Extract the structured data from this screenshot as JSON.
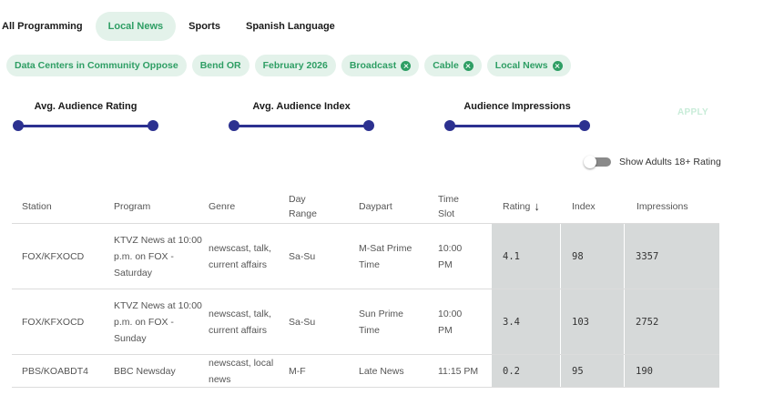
{
  "tabs": [
    {
      "label": "All Programming",
      "active": false
    },
    {
      "label": "Local News",
      "active": true
    },
    {
      "label": "Sports",
      "active": false
    },
    {
      "label": "Spanish Language",
      "active": false
    }
  ],
  "filters": [
    {
      "label": "Data Centers in Community Oppose",
      "removable": false
    },
    {
      "label": "Bend OR",
      "removable": false
    },
    {
      "label": "February 2026",
      "removable": false
    },
    {
      "label": "Broadcast",
      "removable": true
    },
    {
      "label": "Cable",
      "removable": true
    },
    {
      "label": "Local News",
      "removable": true
    }
  ],
  "sliders": [
    {
      "label": "Avg. Audience Rating"
    },
    {
      "label": "Avg. Audience Index"
    },
    {
      "label": "Audience Impressions"
    }
  ],
  "apply_label": "APPLY",
  "toggle": {
    "label": "Show Adults 18+ Rating",
    "on": false
  },
  "table": {
    "headers": {
      "station": "Station",
      "program": "Program",
      "genre": "Genre",
      "day_range": "Day Range",
      "daypart": "Daypart",
      "time_slot": "Time Slot",
      "rating": "Rating",
      "index": "Index",
      "impressions": "Impressions"
    },
    "sort_icon": "arrow-down-icon",
    "rows": [
      {
        "station": "FOX/KFXOCD",
        "program": "KTVZ News at 10:00 p.m. on FOX - Saturday",
        "genre": "newscast, talk, current affairs",
        "day_range": "Sa-Su",
        "daypart": "M-Sat Prime Time",
        "time_slot": "10:00 PM",
        "rating": "4.1",
        "index": "98",
        "impressions": "3357"
      },
      {
        "station": "FOX/KFXOCD",
        "program": "KTVZ News at 10:00 p.m. on FOX - Sunday",
        "genre": "newscast, talk, current affairs",
        "day_range": "Sa-Su",
        "daypart": "Sun Prime Time",
        "time_slot": "10:00 PM",
        "rating": "3.4",
        "index": "103",
        "impressions": "2752"
      },
      {
        "station": "PBS/KOABDT4",
        "program": "BBC Newsday",
        "genre": "newscast, local news",
        "day_range": "M-F",
        "daypart": "Late News",
        "time_slot": "11:15 PM",
        "rating": "0.2",
        "index": "95",
        "impressions": "190"
      }
    ]
  },
  "colors": {
    "accent_green": "#2e9e64",
    "chip_bg": "#e3f2ea",
    "slider_navy": "#2c3190",
    "metric_shade": "#d6d9d9"
  }
}
